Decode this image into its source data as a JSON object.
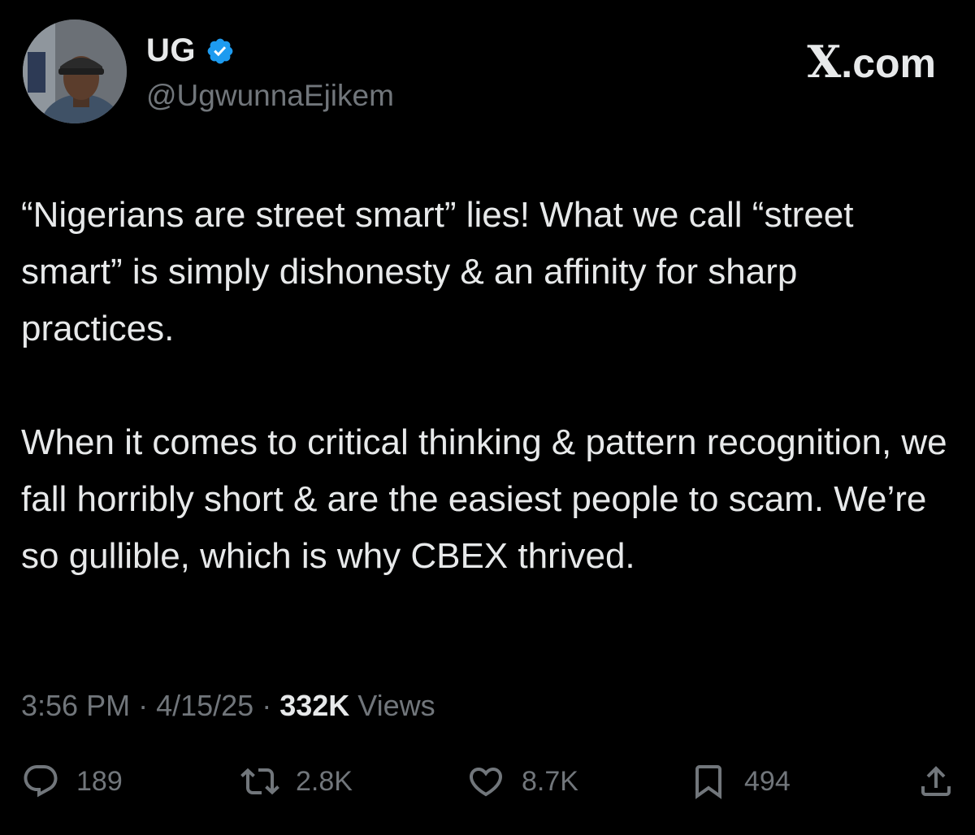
{
  "header": {
    "display_name": "UG",
    "handle": "@UgwunnaEjikem",
    "brand_x": "X",
    "brand_suffix": ".com",
    "avatar_icon": "user-avatar",
    "verified_icon": "verified-badge-icon"
  },
  "tweet": {
    "paragraphs": [
      "“Nigerians are street smart” lies! What we call “street smart” is simply dishonesty & an affinity for sharp practices.",
      "When it comes to critical thinking & pattern recognition, we fall horribly short & are the easiest people to scam. We’re so gullible, which is why CBEX thrived."
    ]
  },
  "meta": {
    "time": "3:56 PM",
    "separator": "·",
    "date": "4/15/25",
    "views_count": "332K",
    "views_label": "Views"
  },
  "actions": {
    "reply_count": "189",
    "retweet_count": "2.8K",
    "like_count": "8.7K",
    "bookmark_count": "494"
  },
  "colors": {
    "background": "#000000",
    "text_primary": "#e7e9ea",
    "text_secondary": "#71767b",
    "verified_blue": "#1d9bf0"
  }
}
